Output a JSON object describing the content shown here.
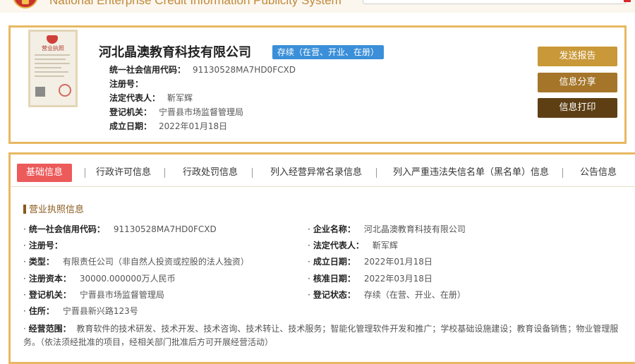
{
  "system_title": "National Enterprise Credit Information Publicity System",
  "license": {
    "title": "营业执照"
  },
  "company": {
    "name": "河北晶澳教育科技有限公司",
    "status": "存续（在营、开业、在册）",
    "credit_code_label": "统一社会信用代码：",
    "credit_code": "91130528MA7HD0FCXD",
    "reg_no_label": "注册号：",
    "reg_no": "",
    "legal_rep_label": "法定代表人：",
    "legal_rep": "靳军辉",
    "authority_label": "登记机关：",
    "authority": "宁晋县市场监督管理局",
    "est_date_label": "成立日期：",
    "est_date": "2022年01月18日"
  },
  "buttons": {
    "report": "发送报告",
    "share": "信息分享",
    "print": "信息打印"
  },
  "tabs": [
    "基础信息",
    "行政许可信息",
    "行政处罚信息",
    "列入经营异常名录信息",
    "列入严重违法失信名单（黑名单）信息",
    "公告信息"
  ],
  "section_title": "营业执照信息",
  "details": {
    "credit_code": {
      "label": "统一社会信用代码：",
      "value": "91130528MA7HD0FCXD"
    },
    "company_name": {
      "label": "企业名称：",
      "value": "河北晶澳教育科技有限公司"
    },
    "reg_no": {
      "label": "注册号：",
      "value": ""
    },
    "legal_rep": {
      "label": "法定代表人：",
      "value": "靳军辉"
    },
    "type": {
      "label": "类型：",
      "value": "有限责任公司（非自然人投资或控股的法人独资）"
    },
    "est_date": {
      "label": "成立日期：",
      "value": "2022年01月18日"
    },
    "capital": {
      "label": "注册资本：",
      "value": "30000.000000万人民币"
    },
    "approval_date": {
      "label": "核准日期：",
      "value": "2022年03月18日"
    },
    "authority": {
      "label": "登记机关：",
      "value": "宁晋县市场监督管理局"
    },
    "reg_status": {
      "label": "登记状态：",
      "value": "存续（在营、开业、在册）"
    },
    "address": {
      "label": "住所：",
      "value": "宁晋县新兴路123号"
    },
    "scope": {
      "label": "经营范围：",
      "value": "教育软件的技术研发、技术开发、技术咨询、技术转让、技术服务；智能化管理软件开发和推广；学校基础设施建设；教育设备销售；物业管理服务。（依法须经批准的项目，经相关部门批准后方可开展经营活动）"
    }
  },
  "colors": {
    "accent": "#e8b862",
    "active_tab": "#ec5a5a",
    "status_badge": "#3a8fd8"
  }
}
